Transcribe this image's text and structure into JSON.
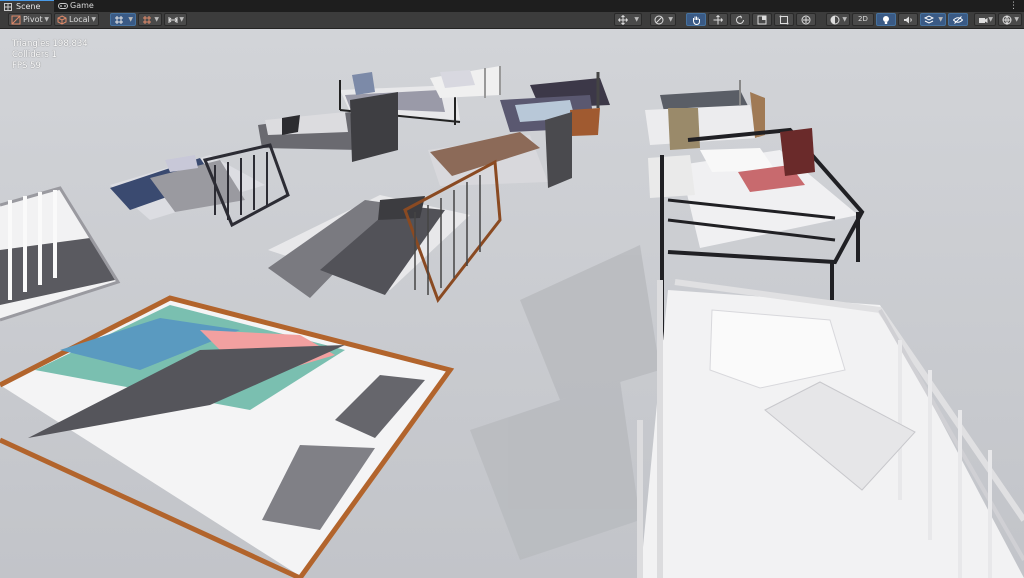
{
  "tabs": [
    {
      "label": "Scene",
      "icon": "scene-grid-icon",
      "active": true
    },
    {
      "label": "Game",
      "icon": "gamepad-icon",
      "active": false
    }
  ],
  "toolbar": {
    "pivot_label": "Pivot",
    "local_label": "Local",
    "mode_2d_label": "2D"
  },
  "stats": {
    "triangles": "Triangles 198,834",
    "colliders": "Colliders 1",
    "fps": "FPS 59"
  },
  "colors": {
    "tab_bar": "#1e1e1e",
    "toolbar": "#3c3c3c",
    "active_tool": "#3a5a85",
    "viewport_background": "#c8cacf",
    "stats_text": "#ffffff"
  }
}
